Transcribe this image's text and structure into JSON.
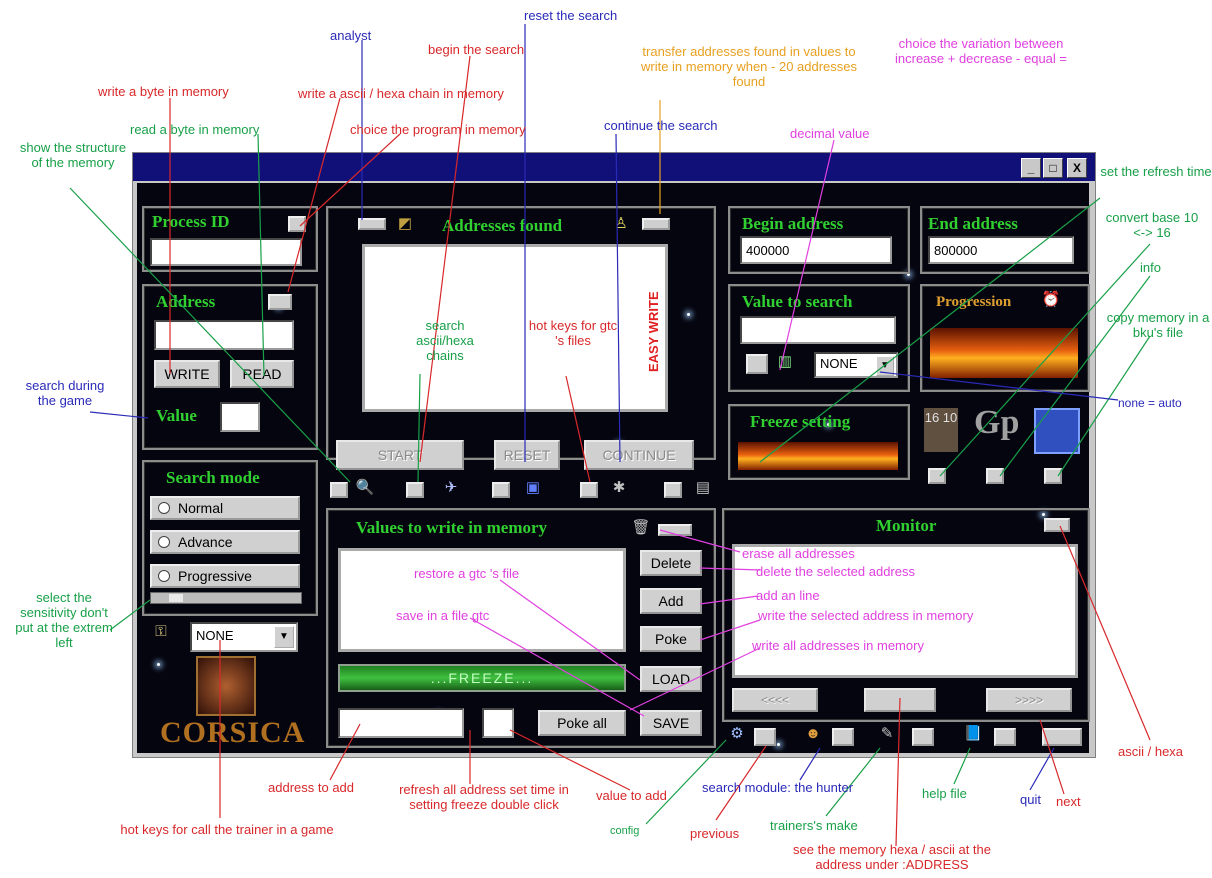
{
  "window": {
    "min": "_",
    "max": "□",
    "close": "X"
  },
  "process": {
    "title": "Process ID",
    "value": ""
  },
  "address": {
    "title": "Address",
    "value": "",
    "write": "WRITE",
    "read": "READ",
    "value_label": "Value",
    "value_field": ""
  },
  "search_mode": {
    "title": "Search mode",
    "options": [
      "Normal",
      "Advance",
      "Progressive"
    ]
  },
  "hotkeys": {
    "selected": "NONE"
  },
  "logo": "CORSICA",
  "found": {
    "title": "Addresses found",
    "side_text": "EASY WRITE",
    "start": "START",
    "reset": "RESET",
    "continue": "CONTINUE"
  },
  "begin": {
    "title": "Begin address",
    "value": "400000"
  },
  "end": {
    "title": "End address",
    "value": "800000"
  },
  "value_search": {
    "title": "Value to search",
    "value": "",
    "variation": "NONE"
  },
  "progression": {
    "title": "Progression"
  },
  "freeze": {
    "title": "Freeze setting",
    "button": "...FREEZE..."
  },
  "write_values": {
    "title": "Values to write in memory",
    "delete": "Delete",
    "add": "Add",
    "poke": "Poke",
    "load": "LOAD",
    "save": "SAVE",
    "poke_all": "Poke all"
  },
  "monitor": {
    "title": "Monitor",
    "prev": "<<<<",
    "next": ">>>>"
  },
  "icons": {
    "base": "16 10",
    "gp": "Gp"
  },
  "annotations": {
    "analyst": "analyst",
    "reset_search": "reset the search",
    "begin_search": "begin the search",
    "write_byte": "write a byte in memory",
    "write_ascii": "write a ascii / hexa chain in memory",
    "transfer": "transfer addresses found in values to write in memory when - 20 addresses found",
    "variation": "choice the variation between increase + decrease - equal =",
    "read_byte": "read a byte in memory",
    "choice_program": "choice the program in memory",
    "continue_search": "continue the search",
    "decimal": "decimal value",
    "show_structure": "show the structure of the memory",
    "refresh": "set the refresh time",
    "convert": "convert base 10 <-> 16",
    "info": "info",
    "copy_memory": "copy memory in a bku's file",
    "search_ascii": "search ascii/hexa chains",
    "hot_gtc": "hot keys for gtc 's files",
    "search_game": "search during the game",
    "none_auto": "none = auto",
    "erase": "erase all addresses",
    "delete_sel": "delete the selected address",
    "add_line": "add an line",
    "write_sel": "write the selected address in memory",
    "write_all": "write all addresses in memory",
    "restore": "restore a gtc 's file",
    "save_gtc": "save in a file gtc",
    "sensitivity": "select the sensitivity don't put at the extrem left",
    "ascii_hexa": "ascii / hexa",
    "address_to_add": "address to add",
    "refresh_all": "refresh all address set time in setting freeze double click",
    "value_to_add": "value to add",
    "search_module": "search module: the hunter",
    "help_file": "help file",
    "quit": "quit",
    "next": "next",
    "config": "config",
    "previous": "previous",
    "trainers_make": "trainers's make",
    "see_memory": "see the memory hexa / ascii at the address under :ADDRESS",
    "hot_trainer": "hot keys for call the trainer in a game"
  }
}
